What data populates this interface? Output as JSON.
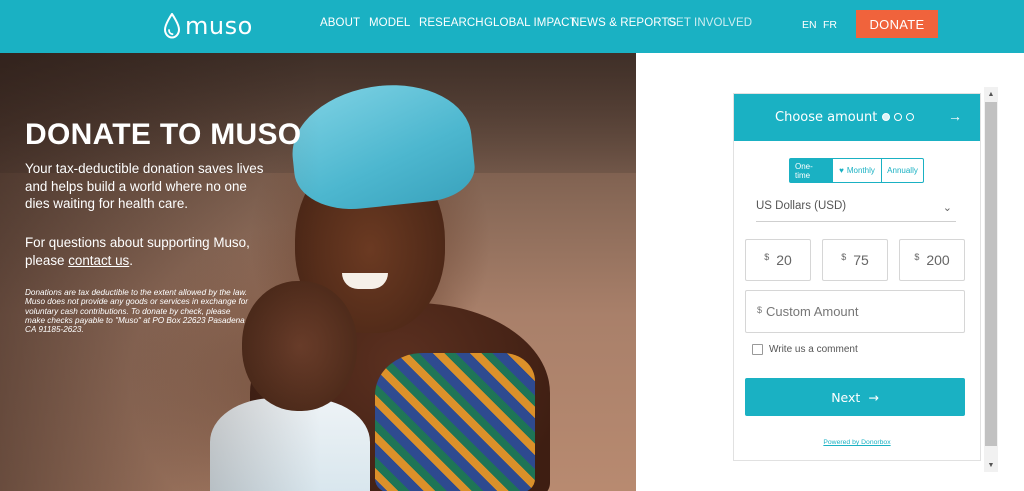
{
  "brand": {
    "logo_text": "muso"
  },
  "nav": {
    "items": [
      {
        "label": "ABOUT"
      },
      {
        "label": "MODEL"
      },
      {
        "label": "RESEARCH"
      },
      {
        "label": "GLOBAL IMPACT"
      },
      {
        "label": "NEWS & REPORTS"
      },
      {
        "label": "GET INVOLVED"
      }
    ],
    "lang_en": "EN",
    "lang_fr": "FR",
    "donate_label": "DONATE"
  },
  "hero": {
    "title": "DONATE TO MUSO",
    "lead": "Your tax-deductible donation saves lives and helps build a world where no one dies waiting for health care.",
    "contact_prefix": "For questions about supporting Muso, please ",
    "contact_link": "contact us",
    "contact_suffix": ".",
    "fine_print": "Donations are tax deductible to the extent allowed by the law. Muso does not provide any goods or services in exchange for voluntary cash contributions. To donate by check, please make checks payable to \"Muso\" at PO Box 22623 Pasadena CA 91185-2623."
  },
  "widget": {
    "title": "Choose amount",
    "frequency": {
      "one_time": "One-time",
      "monthly": "Monthly",
      "annually": "Annually",
      "selected": "One-time"
    },
    "currency": "US Dollars (USD)",
    "currency_symbol": "$",
    "amounts": [
      "20",
      "75",
      "200"
    ],
    "custom_placeholder": "Custom Amount",
    "comment_label": "Write us a comment",
    "next_label": "Next",
    "powered_by": "Powered by Donorbox"
  },
  "colors": {
    "brand_teal": "#1ab1c3",
    "donate_orange": "#f0633c"
  }
}
